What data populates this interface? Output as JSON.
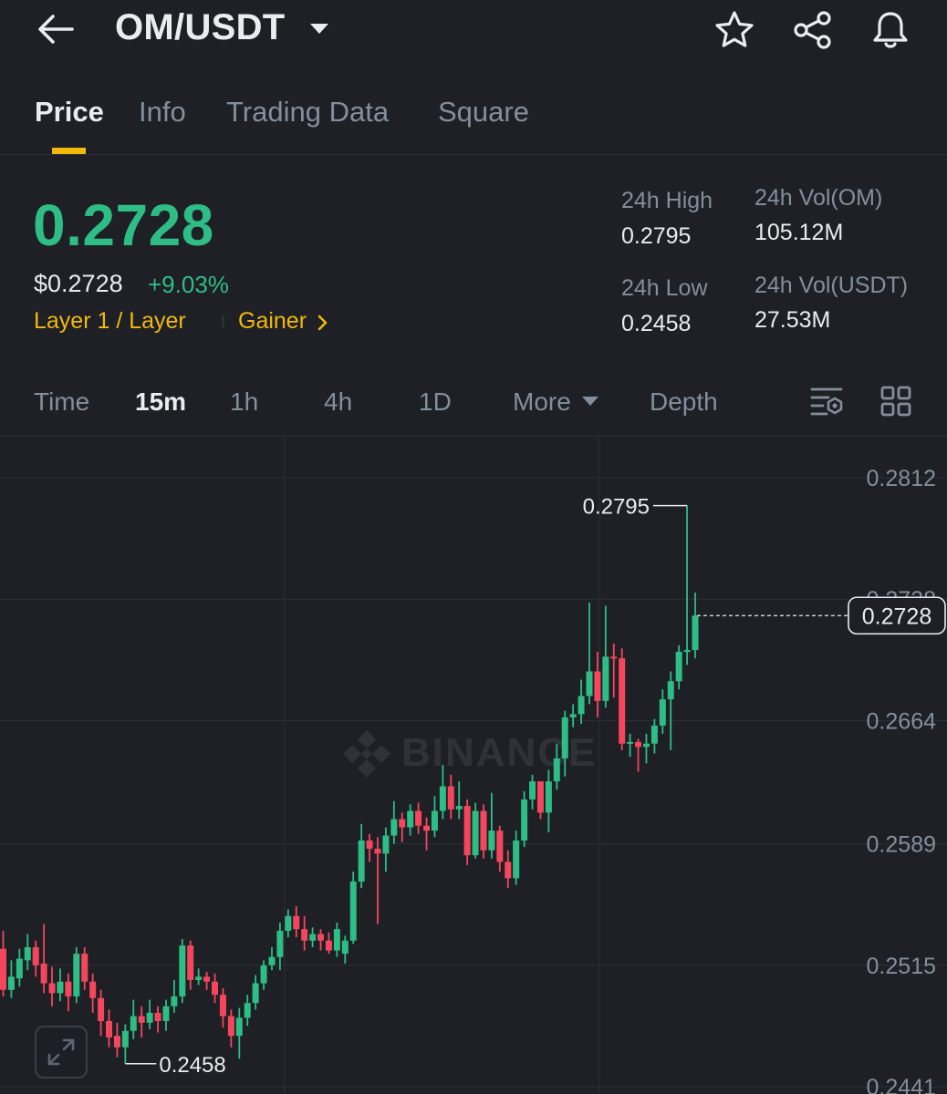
{
  "header": {
    "pair": "OM/USDT",
    "icons": [
      "back-arrow-icon",
      "chevron-down-icon",
      "star-icon",
      "share-icon",
      "bell-icon"
    ]
  },
  "tabs": [
    "Price",
    "Info",
    "Trading Data",
    "Square"
  ],
  "ticker": {
    "last_price": "0.2728",
    "usd_price": "$0.2728",
    "change": "+9.03%",
    "tag_1": "Layer 1 / Layer",
    "tag_2": "Gainer",
    "high_label": "24h High",
    "high_value": "0.2795",
    "low_label": "24h Low",
    "low_value": "0.2458",
    "vol_om_label": "24h Vol(OM)",
    "vol_om_value": "105.12M",
    "vol_usdt_label": "24h Vol(USDT)",
    "vol_usdt_value": "27.53M"
  },
  "timeframes": {
    "time": "Time",
    "m15": "15m",
    "h1": "1h",
    "h4": "4h",
    "d1": "1D",
    "more": "More",
    "depth": "Depth"
  },
  "colors": {
    "up": "#2ebd85",
    "down": "#f6465d",
    "accent": "#f0b90b",
    "background": "#1e2026"
  },
  "watermark": "BINANCE",
  "chart_data": {
    "type": "candlestick",
    "interval": "15m",
    "y_ticks": [
      "0.2812",
      "0.2738",
      "0.2664",
      "0.2589",
      "0.2515",
      "0.2441"
    ],
    "ylim": [
      0.2436,
      0.2837
    ],
    "high_marker": "0.2795",
    "low_marker": "0.2458",
    "current_price": "0.2728",
    "candles": [
      [
        0.2525,
        0.25,
        0.2536,
        0.2496
      ],
      [
        0.25,
        0.2508,
        0.2518,
        0.2495
      ],
      [
        0.2507,
        0.2519,
        0.2525,
        0.2502
      ],
      [
        0.2518,
        0.2526,
        0.2534,
        0.2512
      ],
      [
        0.2526,
        0.2515,
        0.253,
        0.2508
      ],
      [
        0.2516,
        0.2504,
        0.254,
        0.2498
      ],
      [
        0.2504,
        0.2498,
        0.2514,
        0.249
      ],
      [
        0.2498,
        0.2505,
        0.2513,
        0.2493
      ],
      [
        0.2505,
        0.2496,
        0.251,
        0.2487
      ],
      [
        0.2496,
        0.2522,
        0.2526,
        0.2492
      ],
      [
        0.2522,
        0.2505,
        0.2526,
        0.25
      ],
      [
        0.2505,
        0.2495,
        0.251,
        0.2486
      ],
      [
        0.2495,
        0.2481,
        0.25,
        0.2472
      ],
      [
        0.2481,
        0.2471,
        0.2488,
        0.2465
      ],
      [
        0.2472,
        0.2465,
        0.248,
        0.2459
      ],
      [
        0.2465,
        0.2475,
        0.2479,
        0.2455
      ],
      [
        0.2475,
        0.2484,
        0.2494,
        0.247
      ],
      [
        0.2484,
        0.248,
        0.249,
        0.2471
      ],
      [
        0.248,
        0.2486,
        0.2494,
        0.2476
      ],
      [
        0.2486,
        0.2481,
        0.249,
        0.2474
      ],
      [
        0.2481,
        0.249,
        0.2494,
        0.2475
      ],
      [
        0.249,
        0.2496,
        0.2506,
        0.2486
      ],
      [
        0.2496,
        0.2527,
        0.2531,
        0.2492
      ],
      [
        0.2527,
        0.2506,
        0.253,
        0.25
      ],
      [
        0.2506,
        0.2508,
        0.2513,
        0.2503
      ],
      [
        0.2508,
        0.2505,
        0.2511,
        0.25
      ],
      [
        0.2505,
        0.2497,
        0.251,
        0.2492
      ],
      [
        0.2497,
        0.2484,
        0.2501,
        0.2477
      ],
      [
        0.2484,
        0.2472,
        0.2488,
        0.2465
      ],
      [
        0.2472,
        0.2483,
        0.2489,
        0.2458
      ],
      [
        0.2483,
        0.2492,
        0.2497,
        0.2478
      ],
      [
        0.2492,
        0.2504,
        0.2509,
        0.2488
      ],
      [
        0.2504,
        0.2515,
        0.2518,
        0.25
      ],
      [
        0.2515,
        0.252,
        0.2526,
        0.2512
      ],
      [
        0.252,
        0.2536,
        0.2541,
        0.2512
      ],
      [
        0.2536,
        0.2545,
        0.2549,
        0.2532
      ],
      [
        0.2545,
        0.2537,
        0.2551,
        0.2532
      ],
      [
        0.2537,
        0.253,
        0.2545,
        0.2524
      ],
      [
        0.253,
        0.2534,
        0.2538,
        0.2526
      ],
      [
        0.2534,
        0.253,
        0.2537,
        0.2524
      ],
      [
        0.253,
        0.2524,
        0.2535,
        0.2522
      ],
      [
        0.2524,
        0.2537,
        0.2541,
        0.252
      ],
      [
        0.2522,
        0.253,
        0.2533,
        0.2516
      ],
      [
        0.253,
        0.2566,
        0.2572,
        0.2528
      ],
      [
        0.2566,
        0.2591,
        0.2601,
        0.2562
      ],
      [
        0.2591,
        0.2586,
        0.2595,
        0.2578
      ],
      [
        0.2586,
        0.2583,
        0.2593,
        0.254
      ],
      [
        0.2583,
        0.2594,
        0.2599,
        0.2572
      ],
      [
        0.2594,
        0.2604,
        0.2615,
        0.2589
      ],
      [
        0.2604,
        0.2599,
        0.2608,
        0.259
      ],
      [
        0.2599,
        0.2609,
        0.2613,
        0.2594
      ],
      [
        0.2609,
        0.26,
        0.2614,
        0.2595
      ],
      [
        0.26,
        0.2597,
        0.2605,
        0.2585
      ],
      [
        0.2597,
        0.2609,
        0.2618,
        0.2593
      ],
      [
        0.2609,
        0.2624,
        0.2637,
        0.2604
      ],
      [
        0.2624,
        0.261,
        0.2631,
        0.2604
      ],
      [
        0.261,
        0.2612,
        0.2627,
        0.2604
      ],
      [
        0.2612,
        0.2582,
        0.2616,
        0.2576
      ],
      [
        0.2582,
        0.2609,
        0.2614,
        0.258
      ],
      [
        0.2609,
        0.2585,
        0.2613,
        0.258
      ],
      [
        0.2585,
        0.2597,
        0.262,
        0.258
      ],
      [
        0.2597,
        0.2578,
        0.26,
        0.2572
      ],
      [
        0.2578,
        0.2568,
        0.2585,
        0.2562
      ],
      [
        0.2568,
        0.2591,
        0.2597,
        0.2564
      ],
      [
        0.2591,
        0.2616,
        0.2621,
        0.2587
      ],
      [
        0.2616,
        0.2627,
        0.2631,
        0.261
      ],
      [
        0.2627,
        0.2608,
        0.2627,
        0.2604
      ],
      [
        0.2608,
        0.2627,
        0.2634,
        0.2596
      ],
      [
        0.2627,
        0.2641,
        0.265,
        0.2622
      ],
      [
        0.2641,
        0.2666,
        0.267,
        0.263
      ],
      [
        0.2666,
        0.2668,
        0.2674,
        0.266
      ],
      [
        0.2668,
        0.2679,
        0.2689,
        0.2662
      ],
      [
        0.2679,
        0.2694,
        0.2736,
        0.2674
      ],
      [
        0.2694,
        0.2676,
        0.2706,
        0.2666
      ],
      [
        0.2676,
        0.2703,
        0.2734,
        0.2672
      ],
      [
        0.2703,
        0.2702,
        0.2711,
        0.2678
      ],
      [
        0.2702,
        0.265,
        0.2708,
        0.2646
      ],
      [
        0.265,
        0.2651,
        0.2656,
        0.2642
      ],
      [
        0.2651,
        0.2648,
        0.2653,
        0.2633
      ],
      [
        0.2648,
        0.265,
        0.2656,
        0.2638
      ],
      [
        0.265,
        0.2661,
        0.2665,
        0.2644
      ],
      [
        0.2661,
        0.2677,
        0.2683,
        0.2656
      ],
      [
        0.2677,
        0.2688,
        0.2694,
        0.2646
      ],
      [
        0.2688,
        0.2706,
        0.271,
        0.2683
      ],
      [
        0.2706,
        0.2707,
        0.2795,
        0.2698
      ],
      [
        0.2707,
        0.2728,
        0.2742,
        0.2702
      ]
    ]
  }
}
